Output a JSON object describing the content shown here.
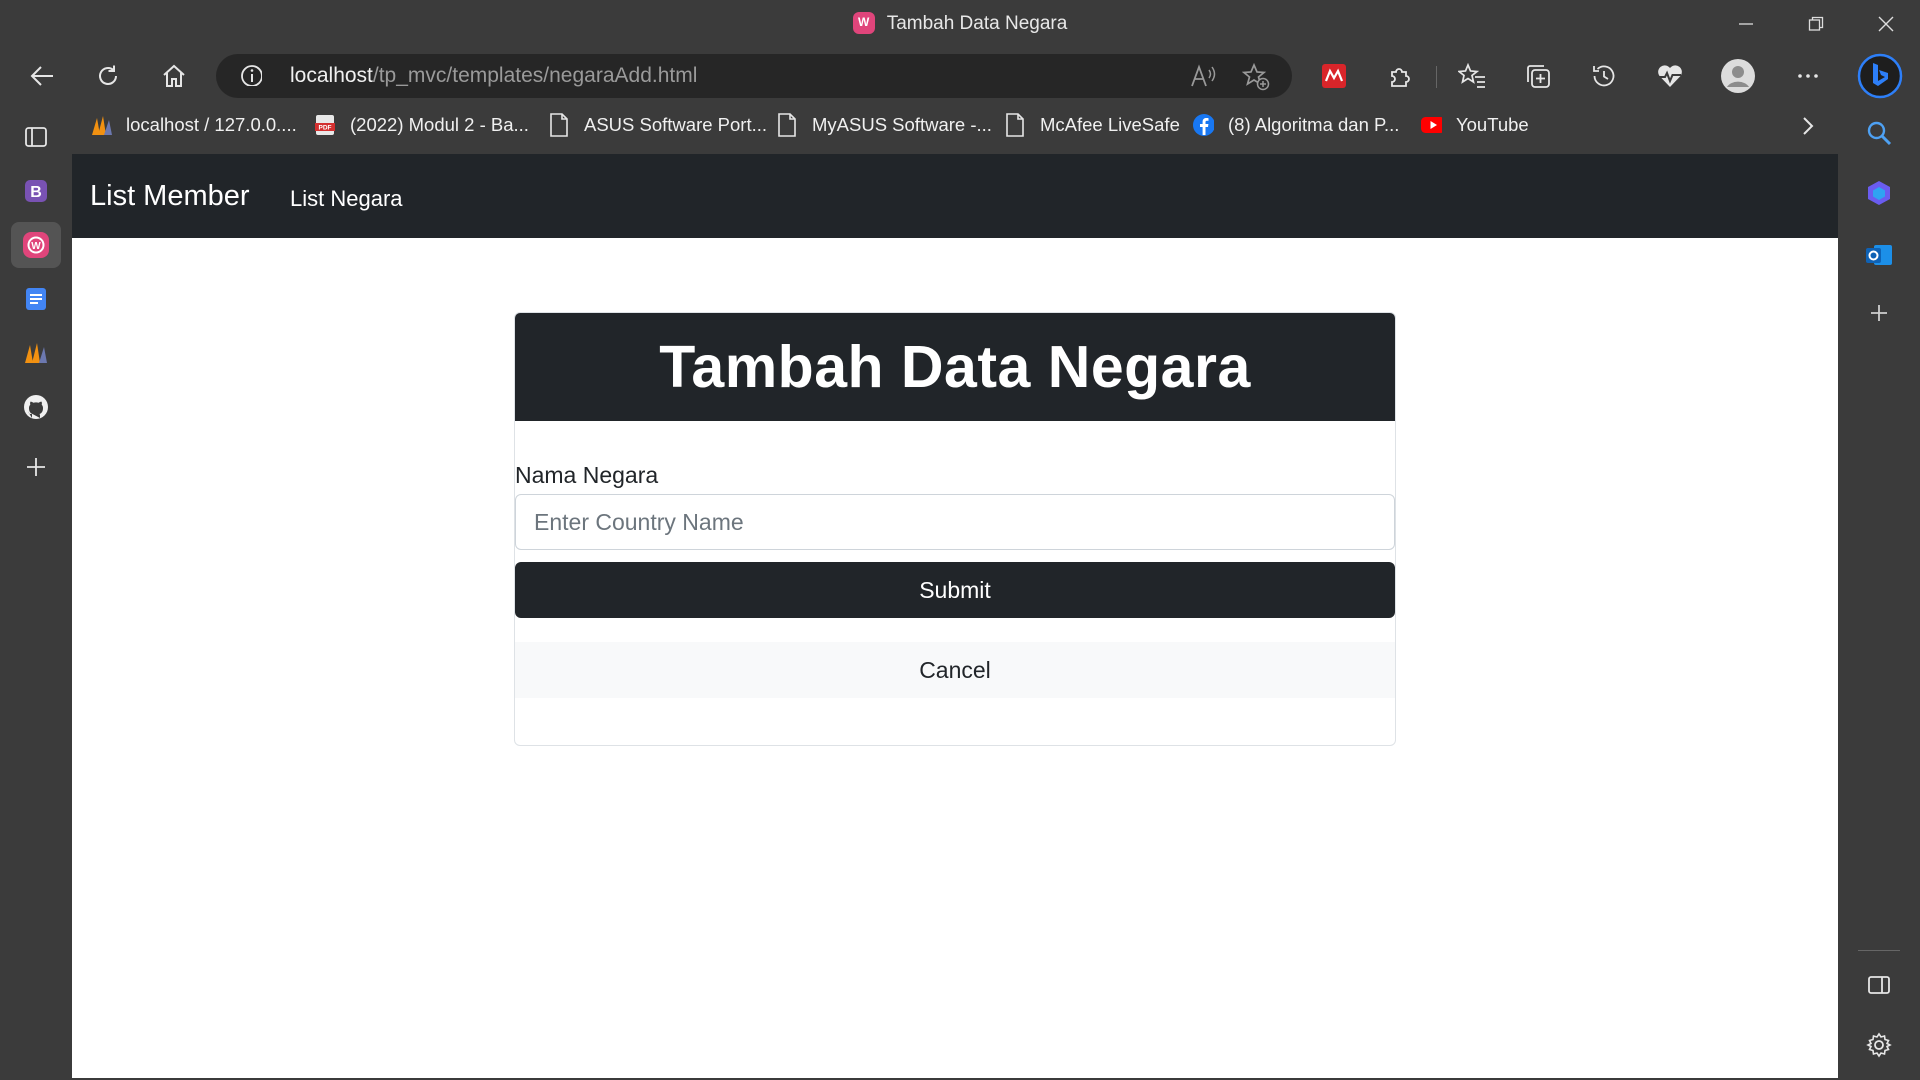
{
  "window": {
    "title": "Tambah Data Negara",
    "controls": [
      "minimize",
      "restore",
      "close"
    ]
  },
  "toolbar": {
    "url_host": "localhost",
    "url_path": "/tp_mvc/templates/negaraAdd.html",
    "read_aloud_label": "Aᴬ"
  },
  "bookmarks": [
    {
      "label": "localhost / 127.0.0....",
      "icon": "phpmyadmin-icon"
    },
    {
      "label": "(2022) Modul 2 - Ba...",
      "icon": "pdf-icon"
    },
    {
      "label": "ASUS Software Port...",
      "icon": "page-icon"
    },
    {
      "label": "MyASUS Software -...",
      "icon": "page-icon"
    },
    {
      "label": "McAfee LiveSafe",
      "icon": "page-icon"
    },
    {
      "label": "(8) Algoritma dan P...",
      "icon": "facebook-icon"
    },
    {
      "label": "YouTube",
      "icon": "youtube-icon"
    }
  ],
  "vertical_tabs": [
    {
      "icon": "tab-actions-icon"
    },
    {
      "icon": "bootstrap-icon"
    },
    {
      "icon": "wampserver-icon",
      "active": true
    },
    {
      "icon": "google-docs-icon"
    },
    {
      "icon": "phpmyadmin-icon"
    },
    {
      "icon": "github-icon"
    },
    {
      "icon": "new-tab-icon"
    }
  ],
  "site": {
    "brand": "List Member",
    "nav_link": "List Negara"
  },
  "form": {
    "heading": "Tambah Data Negara",
    "label": "Nama Negara",
    "input_value": "",
    "placeholder": "Enter Country Name",
    "submit_label": "Submit",
    "cancel_label": "Cancel"
  },
  "colors": {
    "browser_chrome": "#3b3b3b",
    "navbar": "#212529",
    "submit_button": "#212529",
    "cancel_button": "#f8f9fa",
    "favicon_accent": "#e0457b"
  }
}
